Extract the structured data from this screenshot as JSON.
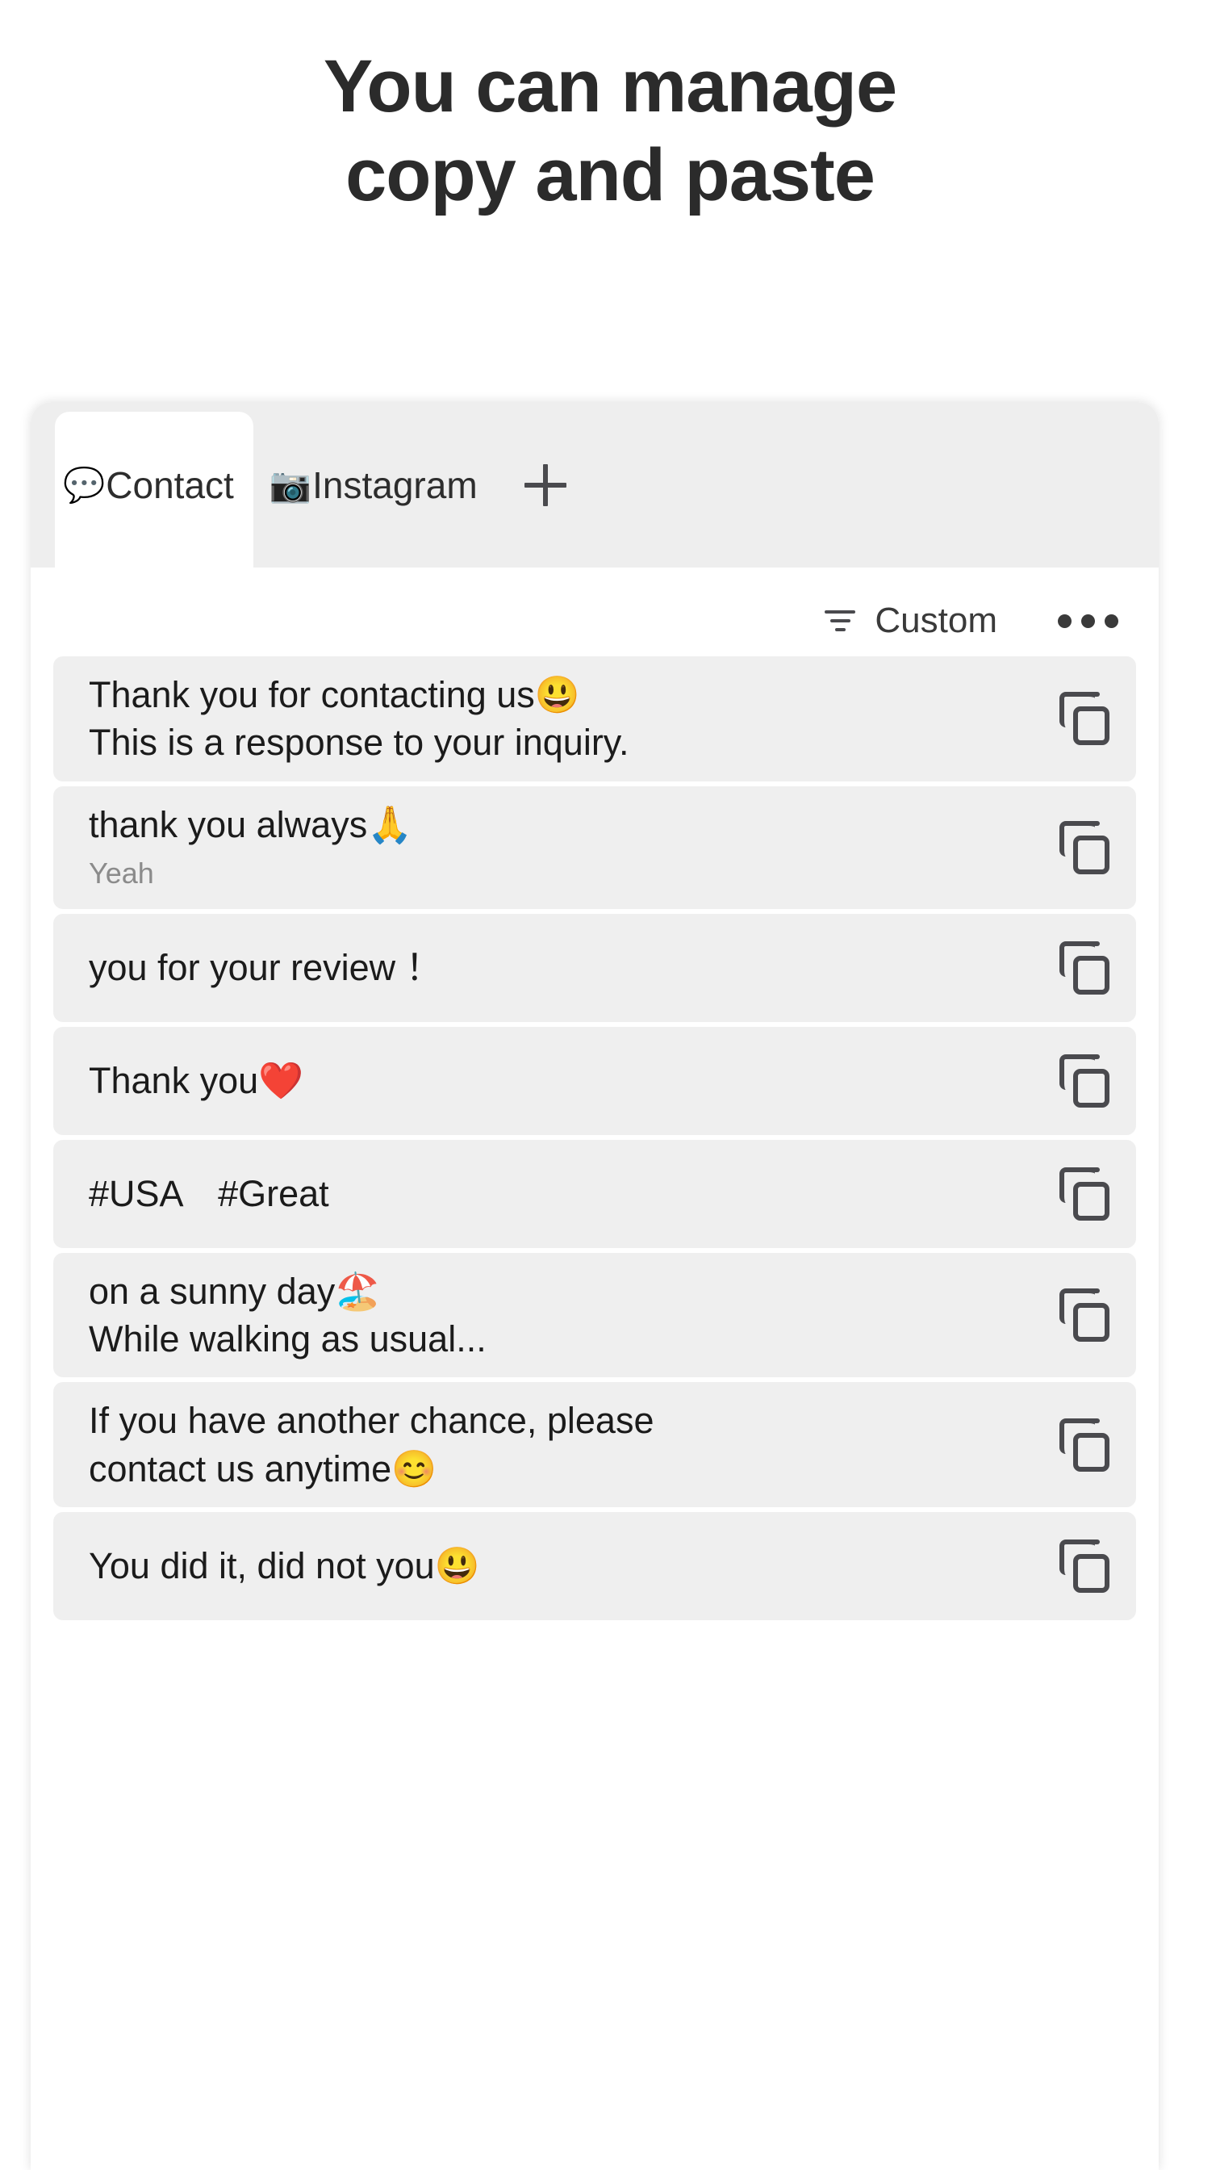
{
  "headline": {
    "line1": "You can manage",
    "line2": "copy and paste"
  },
  "tabs": {
    "items": [
      {
        "emoji": "💬",
        "label": "Contact",
        "active": true
      },
      {
        "emoji": "📷",
        "label": "Instagram",
        "active": false
      }
    ],
    "add_label": "+"
  },
  "toolbar": {
    "filter_label": "Custom",
    "more_label": "•••"
  },
  "list": {
    "items": [
      {
        "main": "Thank you for contacting us😃\nThis is a response to your inquiry.",
        "sub": "",
        "copy_label": "copy"
      },
      {
        "main": "thank you always🙏",
        "sub": "Yeah",
        "copy_label": "copy"
      },
      {
        "main": " you for your review ！",
        "sub": "",
        "copy_label": "copy"
      },
      {
        "main": "Thank you❤️",
        "sub": "",
        "copy_label": "copy"
      },
      {
        "main": "#USA　#Great",
        "sub": "",
        "copy_label": "copy"
      },
      {
        "main": "on a sunny day🏖️\nWhile walking as usual...",
        "sub": "",
        "copy_label": "copy"
      },
      {
        "main": "If you have another chance, please\ncontact us anytime😊",
        "sub": "",
        "copy_label": "copy"
      },
      {
        "main": "You did it, did not you😃",
        "sub": "",
        "copy_label": "copy"
      }
    ]
  },
  "colors": {
    "page_background": "#ffffff",
    "headline_text": "#2b2b2b",
    "card_background": "#ffffff",
    "tabstrip_background": "#eeeeee",
    "row_background": "#efefef",
    "row_text": "#1b1b1b",
    "row_subtext": "#8b8b8b",
    "icon": "#4a4a4e"
  }
}
